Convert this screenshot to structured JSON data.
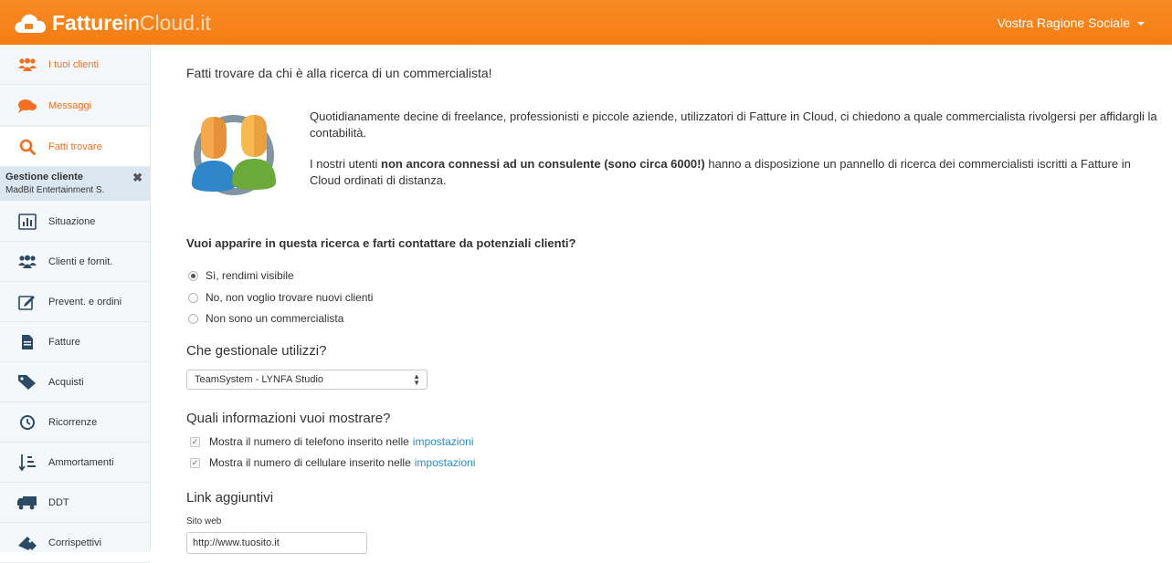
{
  "header": {
    "logo": {
      "bold": "Fatture",
      "in": "in",
      "cloud": "Cloud.it"
    },
    "company_name": "Vostra Ragione Sociale"
  },
  "sidebar": {
    "top_items": [
      {
        "label": "I tuoi clienti",
        "icon": "users-icon"
      },
      {
        "label": "Messaggi",
        "icon": "chat-icon"
      },
      {
        "label": "Fatti trovare",
        "icon": "search-icon"
      }
    ],
    "gestione": {
      "title": "Gestione cliente",
      "client": "MadBit Entertainment S."
    },
    "items": [
      {
        "label": "Situazione",
        "icon": "bar-chart-icon"
      },
      {
        "label": "Clienti e fornit.",
        "icon": "users-icon"
      },
      {
        "label": "Prevent. e ordini",
        "icon": "edit-icon"
      },
      {
        "label": "Fatture",
        "icon": "document-icon"
      },
      {
        "label": "Acquisti",
        "icon": "tags-icon"
      },
      {
        "label": "Ricorrenze",
        "icon": "clock-icon"
      },
      {
        "label": "Ammortamenti",
        "icon": "sort-list-icon"
      },
      {
        "label": "DDT",
        "icon": "truck-icon"
      },
      {
        "label": "Corrispettivi",
        "icon": "ticket-icon"
      }
    ]
  },
  "main": {
    "headline": "Fatti trovare da chi è alla ricerca di un commercialista!",
    "intro_p1": "Quotidianamente decine di freelance, professionisti e piccole aziende, utilizzatori di Fatture in Cloud, ci chiedono a quale commercialista rivolgersi per affidargli la contabilità.",
    "intro_p2_before": "I nostri utenti ",
    "intro_p2_bold": "non ancora connessi ad un consulente (sono circa 6000!)",
    "intro_p2_after": " hanno a disposizione un pannello di ricerca dei commercialisti iscritti a Fatture in Cloud ordinati di distanza.",
    "question": "Vuoi apparire in questa ricerca e farti contattare da potenziali clienti?",
    "radios": [
      {
        "label": "Sì, rendimi visibile",
        "checked": true
      },
      {
        "label": "No, non voglio trovare nuovi clienti",
        "checked": false
      },
      {
        "label": "Non sono un commercialista",
        "checked": false
      }
    ],
    "software_title": "Che gestionale utilizzi?",
    "software_selected": "TeamSystem - LYNFA Studio",
    "info_title": "Quali informazioni vuoi mostrare?",
    "checkboxes": [
      {
        "label": "Mostra il numero di telefono inserito nelle",
        "link": "impostazioni",
        "checked": true
      },
      {
        "label": "Mostra il numero di cellulare inserito nelle",
        "link": "impostazioni",
        "checked": true
      }
    ],
    "links_title": "Link aggiuntivi",
    "website_label": "Sito web",
    "website_value": "http://www.tuosito.it"
  },
  "colors": {
    "brand_orange": "#f7851d",
    "link_blue": "#2a8ecb",
    "sidebar_bg": "#f4f8fb",
    "active_label": "#f26f21"
  }
}
